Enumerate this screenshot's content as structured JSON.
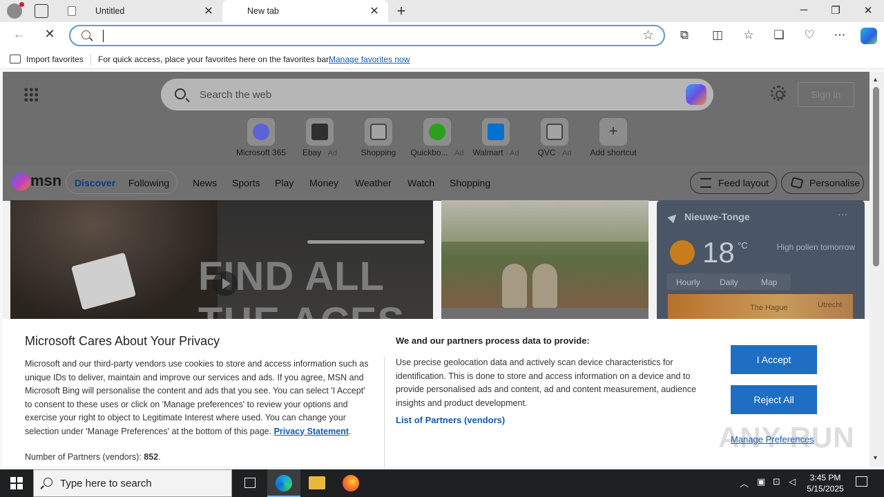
{
  "browser": {
    "tabs": [
      {
        "title": "Untitled",
        "close": "✕"
      },
      {
        "title": "New tab",
        "close": "✕"
      }
    ],
    "new_tab_label": "+",
    "window_controls": {
      "minimize": "─",
      "maximize": "❐",
      "close": "✕"
    },
    "address": {
      "value": "",
      "placeholder": ""
    },
    "favorites_bar": {
      "import_label": "Import favorites",
      "message": "For quick access, place your favorites here on the favorites bar.",
      "manage_link": "Manage favorites now"
    }
  },
  "newtab": {
    "search_placeholder": "Search the web",
    "sign_in": "Sign in",
    "shortcuts": [
      {
        "label": "Microsoft 365",
        "ad": "",
        "color": "#5b63d6"
      },
      {
        "label": "Ebay",
        "ad": "· Ad",
        "color": "#2f2f2f"
      },
      {
        "label": "Shopping",
        "ad": "",
        "color": "#9a9a9a"
      },
      {
        "label": "Quickbo...",
        "ad": "· Ad",
        "color": "#2ca01c"
      },
      {
        "label": "Walmart",
        "ad": "· Ad",
        "color": "#0071ce"
      },
      {
        "label": "QVC",
        "ad": "· Ad",
        "color": "#9a9a9a"
      },
      {
        "label": "Add shortcut",
        "ad": "",
        "color": "#9a9a9a"
      }
    ],
    "msn": {
      "logo": "msn",
      "tabs": [
        "Discover",
        "Following"
      ],
      "nav": [
        "News",
        "Sports",
        "Play",
        "Money",
        "Weather",
        "Watch",
        "Shopping"
      ],
      "feed_layout": "Feed layout",
      "personalise": "Personalise"
    },
    "video_card": {
      "headline": "FIND ALL THE ACES"
    },
    "weather": {
      "location": "Nieuwe-Tonge",
      "temperature": "18",
      "unit": "°C",
      "pollen": "High pollen tomorrow",
      "tabs": [
        "Hourly",
        "Daily",
        "Map"
      ],
      "cities": [
        "The Hague",
        "Utrecht"
      ]
    }
  },
  "privacy": {
    "title": "Microsoft Cares About Your Privacy",
    "body": "Microsoft and our third-party vendors use cookies to store and access information such as unique IDs to deliver, maintain and improve our services and ads. If you agree, MSN and Microsoft Bing will personalise the content and ads that you see. You can select 'I Accept' to consent to these uses or click on 'Manage preferences' to review your options and exercise your right to object to Legitimate Interest where used. You can change your selection under 'Manage Preferences' at the bottom of this page.",
    "privacy_link": "Privacy Statement",
    "partners_label": "Number of Partners (vendors):",
    "partners_count": "852",
    "heading2": "We and our partners process data to provide:",
    "body2": "Use precise geolocation data and actively scan device characteristics for identification. This is done to store and access information on a device and to provide personalised ads and content, ad and content measurement, audience insights and product development.",
    "vendors_link": "List of Partners (vendors)",
    "accept": "I Accept",
    "reject": "Reject All",
    "manage": "Manage Preferences"
  },
  "watermark": "ANY RUN",
  "taskbar": {
    "search_placeholder": "Type here to search",
    "time": "3:45 PM",
    "date": "5/15/2025"
  }
}
